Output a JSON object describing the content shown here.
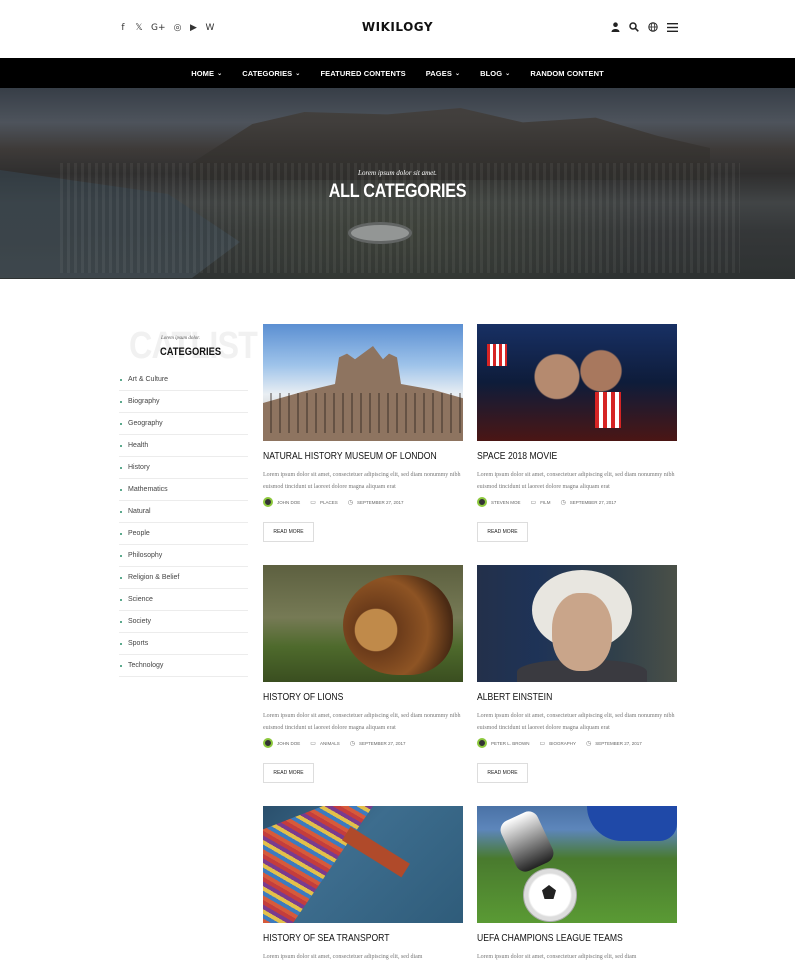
{
  "header": {
    "logo": "WIKILOGY",
    "social_icons": [
      "facebook-icon",
      "twitter-icon",
      "google-plus-icon",
      "instagram-icon",
      "youtube-icon",
      "wikipedia-icon"
    ],
    "social_glyphs": [
      "f",
      "𝕏",
      "G+",
      "◎",
      "▶",
      "W"
    ],
    "tool_icons": [
      "user-icon",
      "search-icon",
      "globe-icon",
      "menu-icon"
    ]
  },
  "nav": {
    "items": [
      {
        "label": "HOME",
        "dropdown": true
      },
      {
        "label": "CATEGORIES",
        "dropdown": true
      },
      {
        "label": "FEATURED CONTENTS",
        "dropdown": false
      },
      {
        "label": "PAGES",
        "dropdown": true
      },
      {
        "label": "BLOG",
        "dropdown": true
      },
      {
        "label": "RANDOM CONTENT",
        "dropdown": false
      }
    ]
  },
  "hero": {
    "subtitle": "Lorem ipsum dolor sit amet.",
    "title": "ALL CATEGORIES"
  },
  "sidebar": {
    "background_text": "CATLIST",
    "subtitle": "Lorem ipsum dolor.",
    "title": "CATEGORIES",
    "accent_color": "#2a8f6a",
    "categories": [
      "Art & Culture",
      "Biography",
      "Geography",
      "Health",
      "History",
      "Mathematics",
      "Natural",
      "People",
      "Philosophy",
      "Religion & Belief",
      "Science",
      "Society",
      "Sports",
      "Technology"
    ]
  },
  "posts": [
    {
      "title": "NATURAL HISTORY MUSEUM OF LONDON",
      "excerpt": "Lorem ipsum dolor sit amet, consectetuer adipiscing elit, sed diam nonummy nibh euismod tincidunt ut laoreet dolore magna aliquam erat",
      "author": "JOHN DOE",
      "category": "PLACES",
      "date": "SEPTEMBER 27, 2017",
      "button": "READ MORE"
    },
    {
      "title": "SPACE 2018 MOVIE",
      "excerpt": "Lorem ipsum dolor sit amet, consectetuer adipiscing elit, sed diam nonummy nibh euismod tincidunt ut laoreet dolore magna aliquam erat",
      "author": "STEVEN MOE",
      "category": "FILM",
      "date": "SEPTEMBER 27, 2017",
      "button": "READ MORE"
    },
    {
      "title": "HISTORY OF LIONS",
      "excerpt": "Lorem ipsum dolor sit amet, consectetuer adipiscing elit, sed diam nonummy nibh euismod tincidunt ut laoreet dolore magna aliquam erat",
      "author": "JOHN DOE",
      "category": "ANIMALS",
      "date": "SEPTEMBER 27, 2017",
      "button": "READ MORE"
    },
    {
      "title": "ALBERT EINSTEIN",
      "excerpt": "Lorem ipsum dolor sit amet, consectetuer adipiscing elit, sed diam nonummy nibh euismod tincidunt ut laoreet dolore magna aliquam erat",
      "author": "PETER L. BROWN",
      "category": "BIOGRAPHY",
      "date": "SEPTEMBER 27, 2017",
      "button": "READ MORE"
    },
    {
      "title": "HISTORY OF SEA TRANSPORT",
      "excerpt": "Lorem ipsum dolor sit amet, consectetuer adipiscing elit, sed diam"
    },
    {
      "title": "UEFA CHAMPIONS LEAGUE TEAMS",
      "excerpt": "Lorem ipsum dolor sit amet, consectetuer adipiscing elit, sed diam"
    }
  ]
}
